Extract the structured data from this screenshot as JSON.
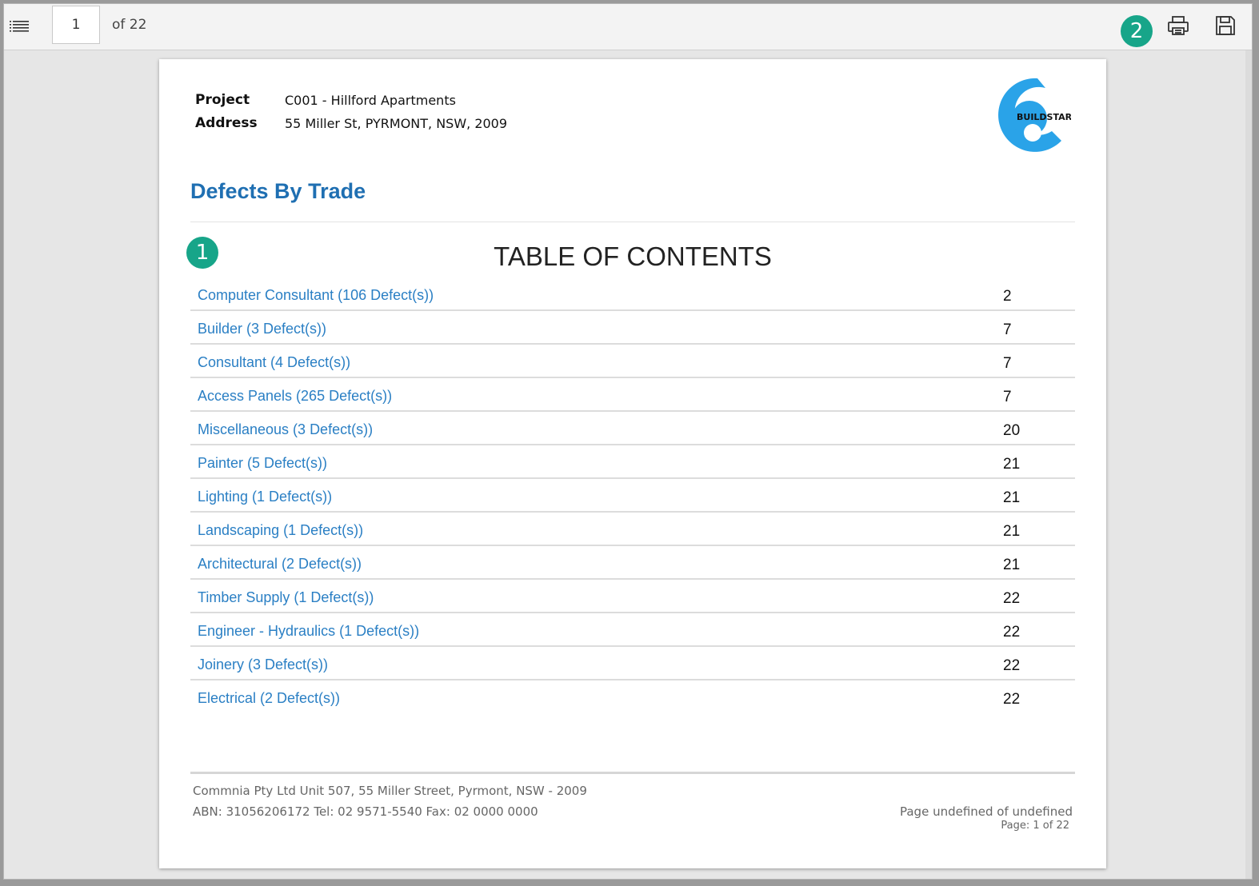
{
  "toolbar": {
    "current_page": "1",
    "page_total_label": "of 22",
    "icons": [
      "table-of-contents-icon",
      "print-icon",
      "save-icon"
    ]
  },
  "callouts": {
    "badge_1": "1",
    "badge_2": "2",
    "color": "#17a589"
  },
  "report": {
    "project_label": "Project",
    "project_value": "C001 -  Hillford Apartments",
    "address_label": "Address",
    "address_value": "55 Miller St, PYRMONT, NSW, 2009",
    "logo_text": "BUILDSTAR",
    "title": "Defects By Trade",
    "toc_heading": "TABLE OF CONTENTS",
    "link_color": "#2a7fc4",
    "title_color": "#1f6fb2"
  },
  "toc": [
    {
      "label": "Computer Consultant (106 Defect(s))",
      "page": "2"
    },
    {
      "label": "Builder (3 Defect(s))",
      "page": "7"
    },
    {
      "label": "Consultant (4 Defect(s))",
      "page": "7"
    },
    {
      "label": "Access Panels (265 Defect(s))",
      "page": "7"
    },
    {
      "label": "Miscellaneous (3 Defect(s))",
      "page": "20"
    },
    {
      "label": "Painter (5 Defect(s))",
      "page": "21"
    },
    {
      "label": "Lighting (1 Defect(s))",
      "page": "21"
    },
    {
      "label": "Landscaping (1 Defect(s))",
      "page": "21"
    },
    {
      "label": "Architectural (2 Defect(s))",
      "page": "21"
    },
    {
      "label": "Timber Supply (1 Defect(s))",
      "page": "22"
    },
    {
      "label": "Engineer - Hydraulics (1 Defect(s))",
      "page": "22"
    },
    {
      "label": "Joinery (3 Defect(s))",
      "page": "22"
    },
    {
      "label": "Electrical (2 Defect(s))",
      "page": "22"
    }
  ],
  "footer": {
    "company_line": "Commnia Pty Ltd Unit 507, 55 Miller Street, Pyrmont, NSW - 2009",
    "contact_line": "ABN: 31056206172 Tel: 02 9571-5540 Fax: 02 0000 0000",
    "page_undefined": "Page undefined of undefined",
    "page_count": "Page: 1 of 22"
  }
}
